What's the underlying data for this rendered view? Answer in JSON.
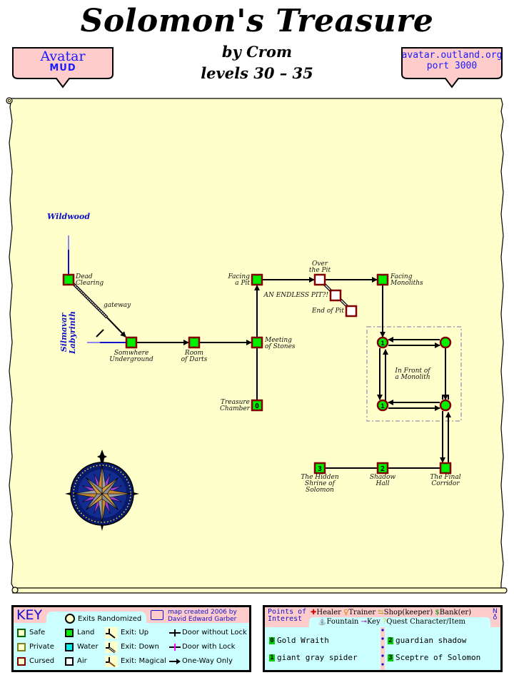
{
  "header": {
    "title": "Solomon's Treasure",
    "author": "by Crom",
    "levels": "levels 30 – 35",
    "left_badge": {
      "line1": "Avatar",
      "line2": "MUD"
    },
    "right_badge": {
      "line1": "avatar.outland.org",
      "line2": "port 3000"
    }
  },
  "colors": {
    "parchment": "#ffffcc",
    "room_land": "#00ee00",
    "room_border_cursed": "#800000",
    "room_air": "#ffffff",
    "zone_link": "#1010cc",
    "key_bg": "#ccffff",
    "key_header": "#ffcccc"
  },
  "map": {
    "zones": [
      {
        "id": "wildwood",
        "label": "Wildwood"
      },
      {
        "id": "silmavar",
        "label": "Silmavar Labyrinth"
      }
    ],
    "rooms": [
      {
        "id": "dead-clearing",
        "label": [
          "Dead",
          "Clearing"
        ],
        "terrain": "land",
        "shape": "square",
        "poi": ""
      },
      {
        "id": "somewhere-underground",
        "label": [
          "Somwhere",
          "Underground"
        ],
        "terrain": "land",
        "shape": "square",
        "poi": ""
      },
      {
        "id": "room-of-darts",
        "label": [
          "Room",
          "of Darts"
        ],
        "terrain": "land",
        "shape": "square",
        "poi": ""
      },
      {
        "id": "meeting-of-stones",
        "label": [
          "Meeting",
          "of Stones"
        ],
        "terrain": "land",
        "shape": "square",
        "poi": ""
      },
      {
        "id": "treasure-chamber",
        "label": [
          "Treasure",
          "Chamber"
        ],
        "terrain": "land",
        "shape": "square",
        "poi": "0"
      },
      {
        "id": "facing-a-pit",
        "label": [
          "Facing",
          "a Pit"
        ],
        "terrain": "land",
        "shape": "square",
        "poi": ""
      },
      {
        "id": "over-the-pit",
        "label": [
          "Over",
          "the Pit"
        ],
        "terrain": "air",
        "shape": "square",
        "poi": ""
      },
      {
        "id": "an-endless-pit",
        "label": [
          "AN ENDLESS PIT?!"
        ],
        "terrain": "air",
        "shape": "square",
        "poi": ""
      },
      {
        "id": "end-of-pit",
        "label": [
          "End of Pit"
        ],
        "terrain": "air",
        "shape": "square",
        "poi": ""
      },
      {
        "id": "facing-monoliths",
        "label": [
          "Facing",
          "Monoliths"
        ],
        "terrain": "land",
        "shape": "square",
        "poi": ""
      },
      {
        "id": "monolith-nw",
        "label": [],
        "terrain": "land",
        "shape": "circle",
        "poi": "1"
      },
      {
        "id": "monolith-ne",
        "label": [],
        "terrain": "land",
        "shape": "circle",
        "poi": ""
      },
      {
        "id": "monolith-sw",
        "label": [],
        "terrain": "land",
        "shape": "circle",
        "poi": "1"
      },
      {
        "id": "monolith-se",
        "label": [],
        "terrain": "land",
        "shape": "circle",
        "poi": ""
      },
      {
        "id": "the-final-corridor",
        "label": [
          "The Final",
          "Corridor"
        ],
        "terrain": "land",
        "shape": "square",
        "poi": ""
      },
      {
        "id": "shadow-hall",
        "label": [
          "Shadow",
          "Hall"
        ],
        "terrain": "land",
        "shape": "square",
        "poi": "2"
      },
      {
        "id": "hidden-shrine",
        "label": [
          "The Hidden",
          "Shrine of",
          "Solomon"
        ],
        "terrain": "land",
        "shape": "square",
        "poi": "3"
      }
    ],
    "region_label": [
      "In Front of",
      "a Monolith"
    ],
    "gateway_label": "gateway"
  },
  "key": {
    "title": "KEY",
    "exits_randomized": "Exits Randomized",
    "credit": [
      "map created 2006 by",
      "David Edward Garber"
    ],
    "zone_types": [
      "Safe",
      "Private",
      "Cursed"
    ],
    "terrain_types": [
      "Land",
      "Water",
      "Air"
    ],
    "exit_types": [
      "Exit: Up",
      "Exit: Down",
      "Exit: Magical"
    ],
    "door_types": [
      "Door without Lock",
      "Door with Lock",
      "One-Way Only"
    ]
  },
  "poi": {
    "title": [
      "Points of",
      "Interest"
    ],
    "legend": [
      "Healer",
      "Trainer",
      "Shop(keeper)",
      "Bank(er)",
      "Fountain",
      "Key",
      "Quest Character/Item"
    ],
    "compass_label": "N",
    "items": [
      {
        "num": "0",
        "label": "Gold Wraith"
      },
      {
        "num": "1",
        "label": "giant gray spider"
      },
      {
        "num": "2",
        "label": "guardian shadow"
      },
      {
        "num": "3",
        "label": "Sceptre of Solomon"
      }
    ]
  }
}
